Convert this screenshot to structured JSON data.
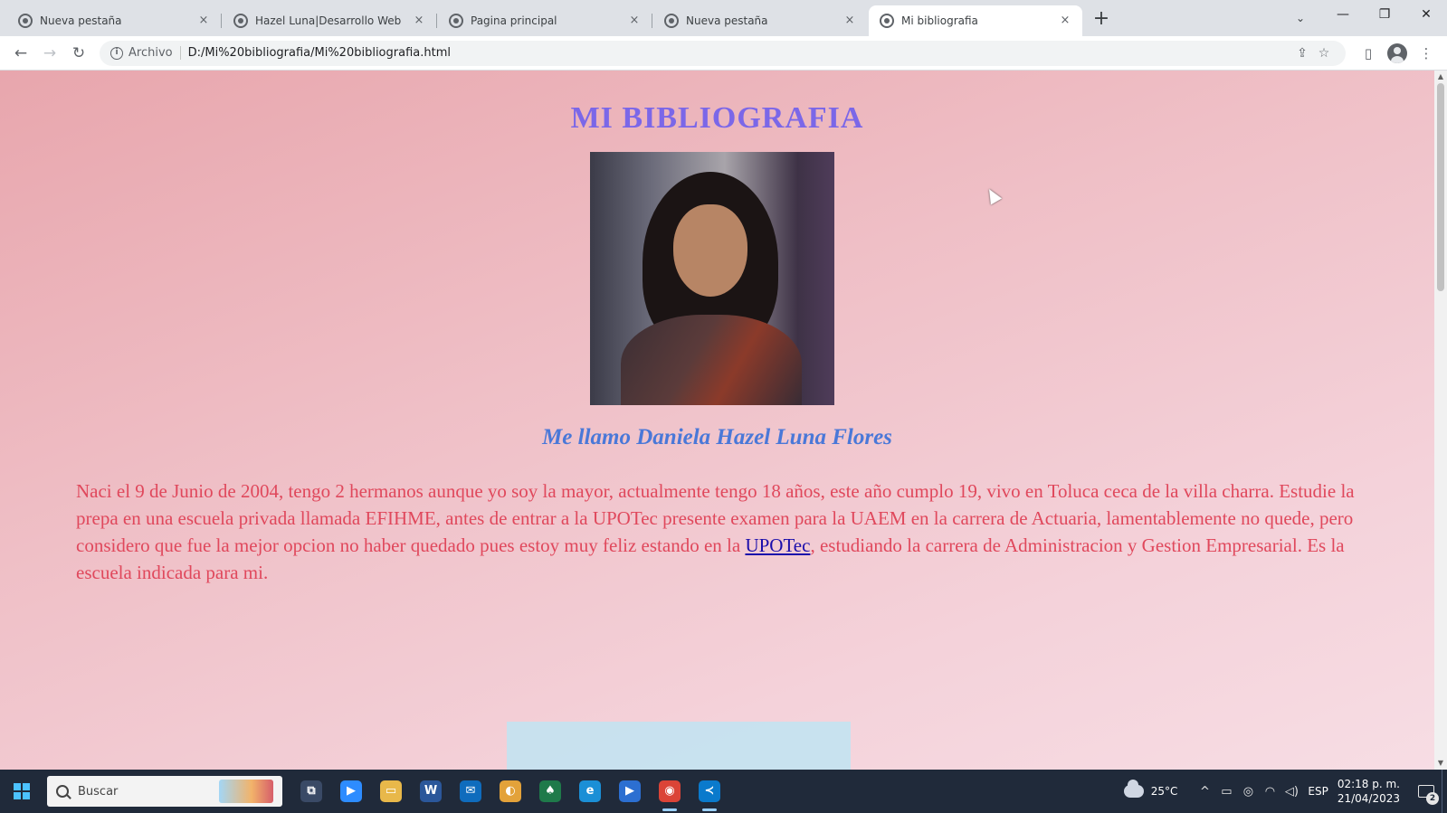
{
  "browser": {
    "tabs": [
      {
        "title": "Nueva pestaña",
        "active": false
      },
      {
        "title": "Hazel Luna|Desarrollo Web",
        "active": false
      },
      {
        "title": "Pagina principal",
        "active": false
      },
      {
        "title": "Nueva pestaña",
        "active": false
      },
      {
        "title": "Mi bibliografia",
        "active": true
      }
    ],
    "close_glyph": "×",
    "new_tab_glyph": "+",
    "tab_search_glyph": "⌄",
    "window_controls": {
      "minimize": "—",
      "maximize": "❐",
      "close": "✕"
    },
    "nav": {
      "back": "←",
      "forward": "→",
      "reload": "↻"
    },
    "address": {
      "info_glyph": "i",
      "scheme_label": "Archivo",
      "url": "D:/Mi%20bibliografia/Mi%20bibliografia.html",
      "share_glyph": "⇪",
      "bookmark_glyph": "☆"
    },
    "toolbar_glyphs": {
      "sidepanel": "▯",
      "menu": "⋮"
    }
  },
  "page": {
    "title": "MI BIBLIOGRAFIA",
    "subtitle": "Me llamo Daniela Hazel Luna Flores",
    "bio_before_link": "Naci el 9 de Junio de 2004, tengo 2 hermanos aunque yo soy la mayor, actualmente tengo 18 años, este año cumplo 19, vivo en Toluca ceca de la villa charra. Estudie la prepa en una escuela privada llamada EFIHME, antes de entrar a la UPOTec presente examen para la UAEM en la carrera de Actuaria, lamentablemente no quede, pero considero que fue la mejor opcion no haber quedado pues estoy muy feliz estando en la ",
    "bio_link": "UPOTec",
    "bio_after_link": ", estudiando la carrera de Administracion y Gestion Empresarial. Es la escuela indicada para mi.",
    "colors": {
      "title": "#7b67e8",
      "subtitle": "#4a78d8",
      "bio": "#e0485c",
      "background_start": "#e8a6ad",
      "background_end": "#f7dde4"
    }
  },
  "taskbar": {
    "search_placeholder": "Buscar",
    "apps": [
      {
        "name": "task-view-icon",
        "glyph": "⧉",
        "color": "#3a4a66"
      },
      {
        "name": "zoom-icon",
        "glyph": "▶",
        "color": "#2d8cff"
      },
      {
        "name": "file-explorer-icon",
        "glyph": "▭",
        "color": "#e8b84a"
      },
      {
        "name": "word-icon",
        "glyph": "W",
        "color": "#2b579a"
      },
      {
        "name": "mail-icon",
        "glyph": "✉",
        "color": "#0f6cbd"
      },
      {
        "name": "photos-icon",
        "glyph": "◐",
        "color": "#e3a23a"
      },
      {
        "name": "solitaire-icon",
        "glyph": "♠",
        "color": "#1f7a4a"
      },
      {
        "name": "edge-icon",
        "glyph": "e",
        "color": "#1b8fd6"
      },
      {
        "name": "media-player-icon",
        "glyph": "▶",
        "color": "#2c6fd1"
      },
      {
        "name": "chrome-icon",
        "glyph": "◉",
        "color": "#db4437"
      },
      {
        "name": "vscode-icon",
        "glyph": "≺",
        "color": "#0a7acc"
      }
    ],
    "weather": "25°C",
    "tray_glyphs": {
      "chevron": "^",
      "battery": "▭",
      "location": "◎",
      "wifi": "◠",
      "volume": "◁)"
    },
    "language": "ESP",
    "time": "02:18 p. m.",
    "date": "21/04/2023",
    "notification_count": "2"
  }
}
